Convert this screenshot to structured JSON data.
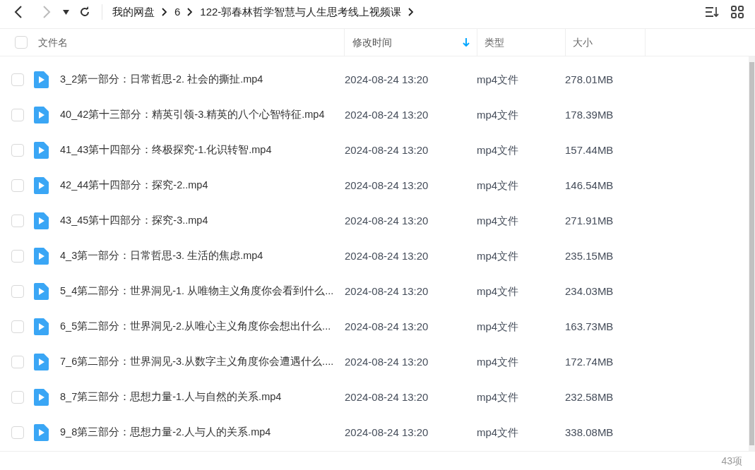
{
  "toolbar": {
    "breadcrumb": [
      {
        "label": "我的网盘"
      },
      {
        "label": "6"
      },
      {
        "label": "122-郭春林哲学智慧与人生思考线上视频课"
      }
    ]
  },
  "table": {
    "select_all": {
      "checked": false
    },
    "columns": [
      {
        "label": "文件名",
        "sorted": false
      },
      {
        "label": "修改时间",
        "sorted": true
      },
      {
        "label": "类型",
        "sorted": false
      },
      {
        "label": "大小",
        "sorted": false
      }
    ],
    "rows": [
      {
        "name": "3_2第一部分：日常哲思-2. 社会的撕扯.mp4",
        "modified": "2024-08-24 13:20",
        "type": "mp4文件",
        "size": "278.01MB",
        "checked": false
      },
      {
        "name": "40_42第十三部分：精英引领-3.精英的八个心智特征.mp4",
        "modified": "2024-08-24 13:20",
        "type": "mp4文件",
        "size": "178.39MB",
        "checked": false
      },
      {
        "name": "41_43第十四部分：终极探究-1.化识转智.mp4",
        "modified": "2024-08-24 13:20",
        "type": "mp4文件",
        "size": "157.44MB",
        "checked": false
      },
      {
        "name": "42_44第十四部分：探究-2..mp4",
        "modified": "2024-08-24 13:20",
        "type": "mp4文件",
        "size": "146.54MB",
        "checked": false
      },
      {
        "name": "43_45第十四部分：探究-3..mp4",
        "modified": "2024-08-24 13:20",
        "type": "mp4文件",
        "size": "271.91MB",
        "checked": false
      },
      {
        "name": "4_3第一部分：日常哲思-3. 生活的焦虑.mp4",
        "modified": "2024-08-24 13:20",
        "type": "mp4文件",
        "size": "235.15MB",
        "checked": false
      },
      {
        "name": "5_4第二部分：世界洞见-1. 从唯物主义角度你会看到什么...",
        "modified": "2024-08-24 13:20",
        "type": "mp4文件",
        "size": "234.03MB",
        "checked": false
      },
      {
        "name": "6_5第二部分：世界洞见-2.从唯心主义角度你会想出什么...",
        "modified": "2024-08-24 13:20",
        "type": "mp4文件",
        "size": "163.73MB",
        "checked": false
      },
      {
        "name": "7_6第二部分：世界洞见-3.从数字主义角度你会遭遇什么....",
        "modified": "2024-08-24 13:20",
        "type": "mp4文件",
        "size": "172.74MB",
        "checked": false
      },
      {
        "name": "8_7第三部分：思想力量-1.人与自然的关系.mp4",
        "modified": "2024-08-24 13:20",
        "type": "mp4文件",
        "size": "232.58MB",
        "checked": false
      },
      {
        "name": "9_8第三部分：思想力量-2.人与人的关系.mp4",
        "modified": "2024-08-24 13:20",
        "type": "mp4文件",
        "size": "338.08MB",
        "checked": false
      }
    ]
  },
  "status_bar": {
    "count": "43项"
  }
}
